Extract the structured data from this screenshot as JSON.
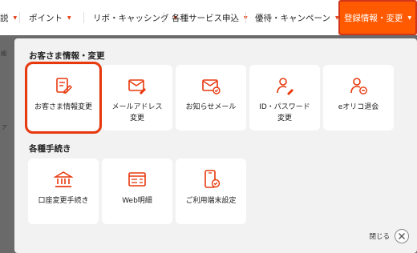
{
  "nav": {
    "items": [
      {
        "label": "説"
      },
      {
        "label": "ポイント"
      },
      {
        "label": "リボ・キャッシング"
      },
      {
        "label": "各種サービス申込"
      },
      {
        "label": "優待・キャンペーン"
      }
    ],
    "active_label": "登録情報・変更"
  },
  "background": {
    "side_text_1": "細",
    "side_text_2": "ア"
  },
  "panel": {
    "section1_title": "お客さま情報・変更",
    "section1_tiles": [
      {
        "label": "お客さま情報変更",
        "icon": "profile-edit-icon"
      },
      {
        "label": "メールアドレス\n変更",
        "icon": "mail-edit-icon"
      },
      {
        "label": "お知らせメール",
        "icon": "mail-check-icon"
      },
      {
        "label": "ID・パスワード\n変更",
        "icon": "user-key-icon"
      },
      {
        "label": "eオリコ退会",
        "icon": "user-remove-icon"
      }
    ],
    "section2_title": "各種手続き",
    "section2_tiles": [
      {
        "label": "口座変更手続き",
        "icon": "bank-icon"
      },
      {
        "label": "Web明細",
        "icon": "web-statement-icon"
      },
      {
        "label": "ご利用端末設定",
        "icon": "device-check-icon"
      }
    ],
    "close_label": "閉じる"
  },
  "colors": {
    "accent": "#ff5a00",
    "accent_border": "#d2361a",
    "icon": "#e8380d"
  }
}
